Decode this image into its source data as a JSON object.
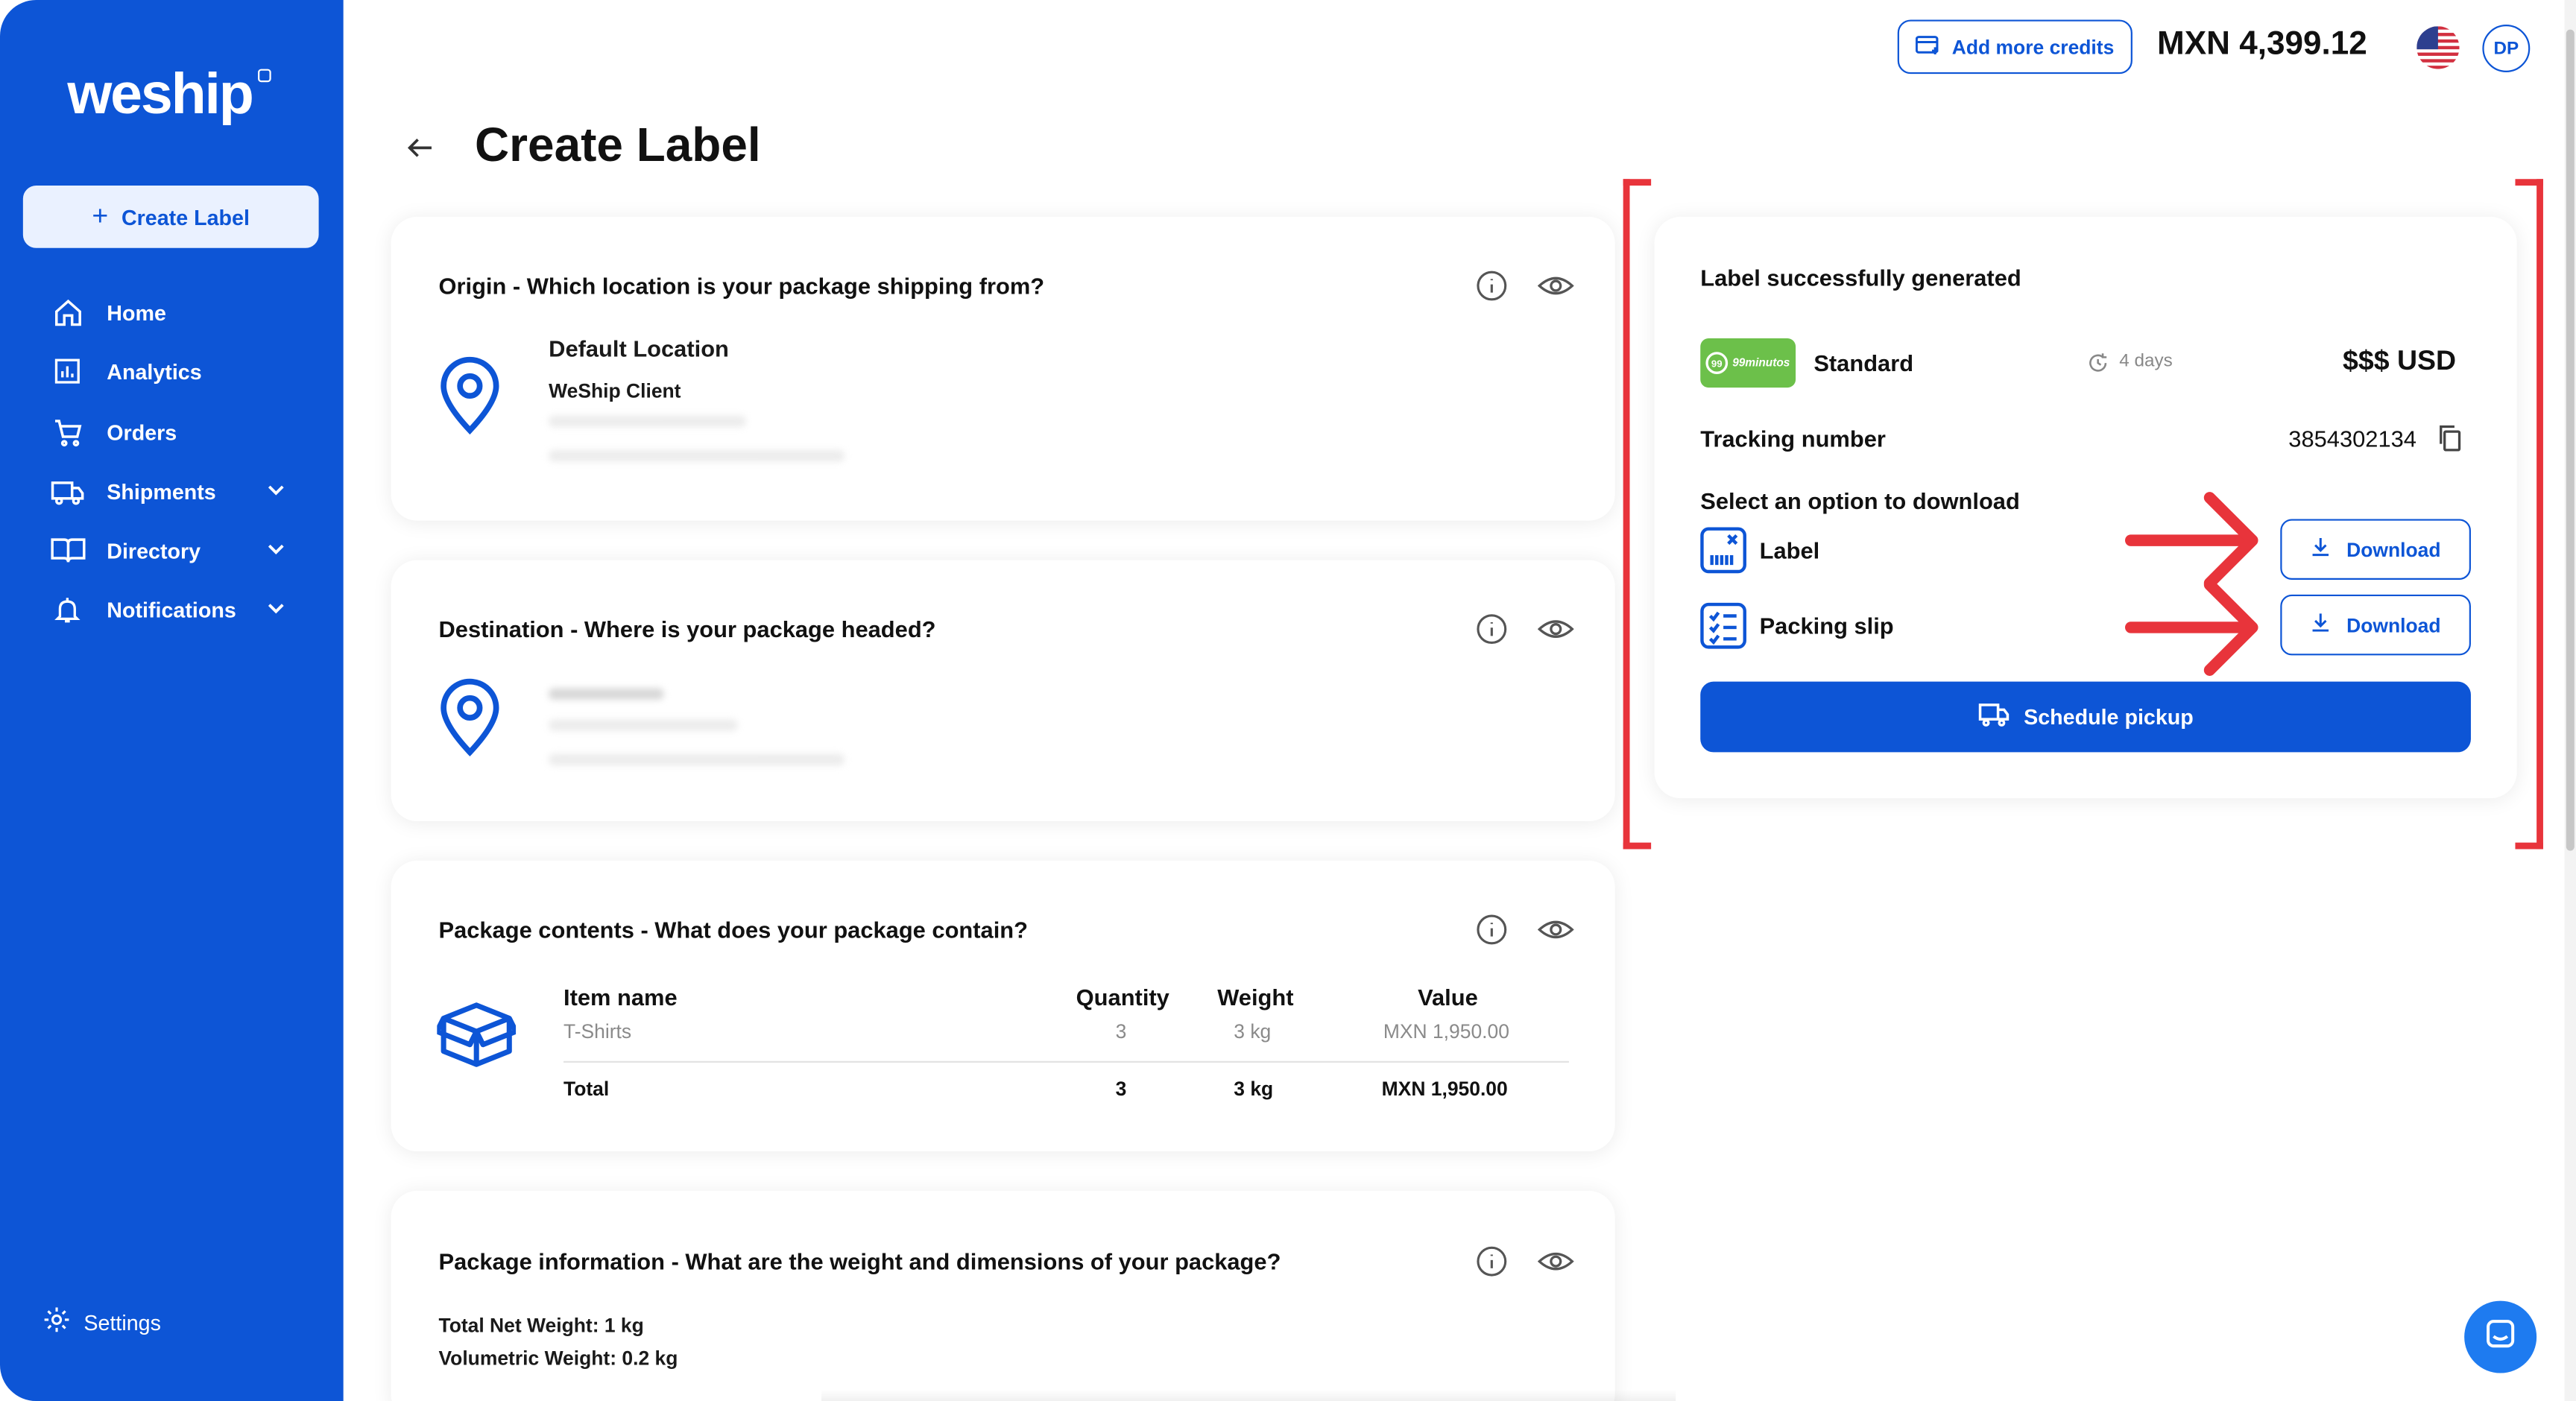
{
  "brand": {
    "name": "weship"
  },
  "sidebar": {
    "create_label": "Create Label",
    "items": [
      {
        "label": "Home",
        "icon": "home-icon"
      },
      {
        "label": "Analytics",
        "icon": "analytics-icon"
      },
      {
        "label": "Orders",
        "icon": "cart-icon"
      },
      {
        "label": "Shipments",
        "icon": "truck-icon",
        "expandable": true
      },
      {
        "label": "Directory",
        "icon": "book-icon",
        "expandable": true
      },
      {
        "label": "Notifications",
        "icon": "bell-icon",
        "expandable": true
      }
    ],
    "settings": "Settings"
  },
  "header": {
    "add_credits": "Add more credits",
    "balance": "MXN 4,399.12",
    "avatar_initials": "DP"
  },
  "page": {
    "title": "Create Label"
  },
  "origin": {
    "title": "Origin - Which location is your package shipping from?",
    "location_name": "Default Location",
    "client": "WeShip Client"
  },
  "destination": {
    "title": "Destination - Where is your package headed?"
  },
  "contents": {
    "title": "Package contents - What does your package contain?",
    "columns": [
      "Item name",
      "Quantity",
      "Weight",
      "Value"
    ],
    "rows": [
      {
        "name": "T-Shirts",
        "quantity": "3",
        "weight": "3 kg",
        "value": "MXN 1,950.00"
      }
    ],
    "total": {
      "label": "Total",
      "quantity": "3",
      "weight": "3 kg",
      "value": "MXN 1,950.00"
    }
  },
  "package_info": {
    "title": "Package information - What are the weight and dimensions of your package?",
    "net_weight": "Total Net Weight: 1 kg",
    "volumetric_weight": "Volumetric Weight: 0.2 kg"
  },
  "result": {
    "heading": "Label successfully generated",
    "carrier_logo": "99minutos",
    "service": "Standard",
    "eta": "4 days",
    "price": "$$$ USD",
    "tracking_label": "Tracking number",
    "tracking_number": "3854302134",
    "download_heading": "Select an option to download",
    "options": [
      {
        "label": "Label",
        "button": "Download"
      },
      {
        "label": "Packing slip",
        "button": "Download"
      }
    ],
    "schedule_pickup": "Schedule pickup"
  },
  "colors": {
    "primary": "#0d55d6",
    "annotation": "#e8343b",
    "carrier_green": "#6cc04a"
  }
}
